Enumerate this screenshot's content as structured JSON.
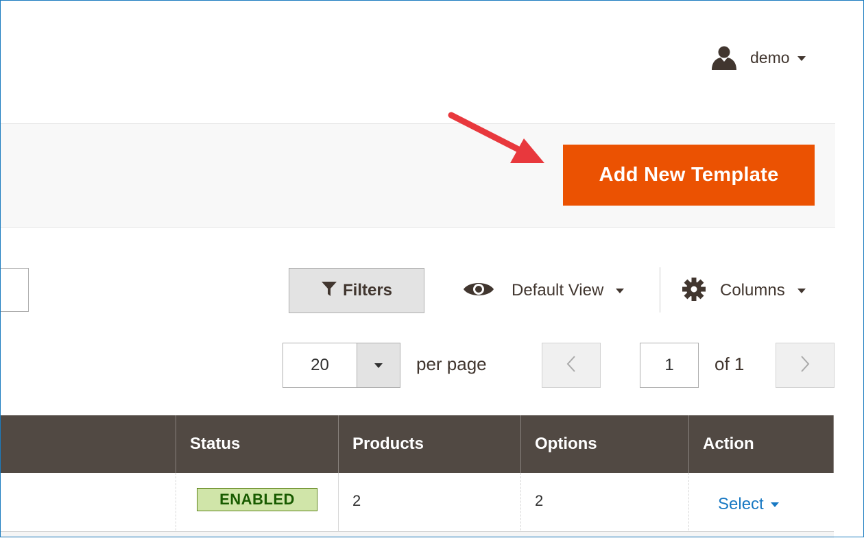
{
  "header": {
    "user_name": "demo",
    "user_icon": "user-icon"
  },
  "page_actions": {
    "add_button_label": "Add New Template",
    "button_color": "#eb5202"
  },
  "toolbar": {
    "filters_label": "Filters",
    "filters_icon": "funnel-icon",
    "view_label": "Default View",
    "view_icon": "eye-icon",
    "columns_label": "Columns",
    "columns_icon": "gear-icon"
  },
  "pager": {
    "per_page_value": "20",
    "per_page_label": "per page",
    "current_page": "1",
    "total_pages_label": "of 1"
  },
  "grid": {
    "columns": [
      "Status",
      "Products",
      "Options",
      "Action"
    ],
    "rows": [
      {
        "status": "ENABLED",
        "products": "2",
        "options": "2",
        "action": "Select"
      }
    ]
  }
}
